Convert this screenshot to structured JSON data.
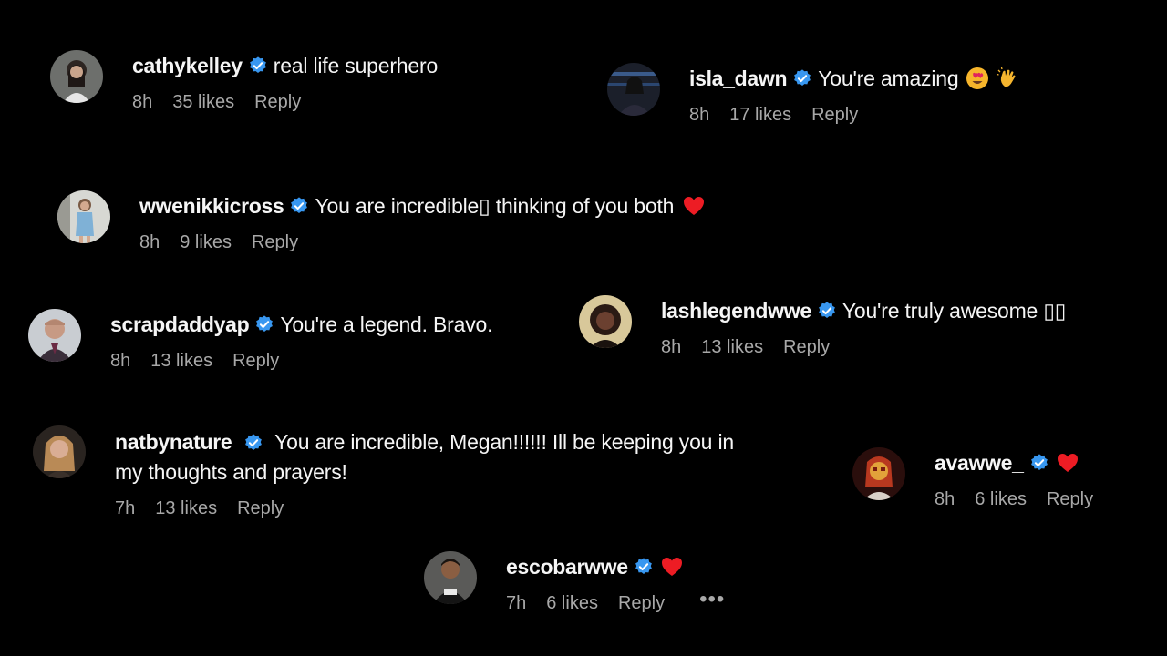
{
  "colors": {
    "background": "#000000",
    "verified": "#3897f0",
    "heart": "#ed1c24",
    "meta_text": "#a8a8a8"
  },
  "icons": {
    "verified": "verified-badge-icon",
    "heart": "red-heart-icon",
    "more": "more-options-icon"
  },
  "comments": [
    {
      "username": "cathykelley",
      "text": "real life superhero",
      "time": "8h",
      "likes": "35 likes",
      "reply": "Reply"
    },
    {
      "username": "isla_dawn",
      "text": "You're amazing",
      "emojis": [
        "heart-eyes-emoji",
        "clapping-hands-emoji"
      ],
      "time": "8h",
      "likes": "17 likes",
      "reply": "Reply"
    },
    {
      "username": "wwenikkicross",
      "text": "You are incredible▯ thinking of you both",
      "time": "8h",
      "likes": "9 likes",
      "reply": "Reply"
    },
    {
      "username": "scrapdaddyap",
      "text": "You're a legend. Bravo.",
      "time": "8h",
      "likes": "13 likes",
      "reply": "Reply"
    },
    {
      "username": "lashlegendwwe",
      "text": "You're truly awesome ▯▯",
      "time": "8h",
      "likes": "13 likes",
      "reply": "Reply"
    },
    {
      "username": "natbynature",
      "text": "You are incredible, Megan!!!!!! Ill be keeping you in my thoughts and prayers!",
      "time": "7h",
      "likes": "13 likes",
      "reply": "Reply"
    },
    {
      "username": "avawwe_",
      "text": "",
      "time": "8h",
      "likes": "6 likes",
      "reply": "Reply"
    },
    {
      "username": "escobarwwe",
      "text": "",
      "time": "7h",
      "likes": "6 likes",
      "reply": "Reply",
      "more": "•••"
    }
  ]
}
